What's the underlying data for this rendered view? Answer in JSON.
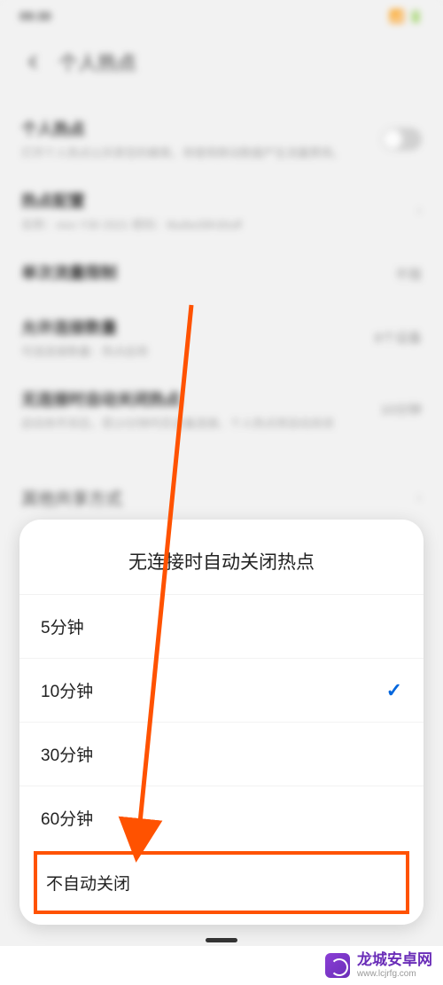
{
  "statusBar": {
    "time": "09:30"
  },
  "header": {
    "title": "个人热点"
  },
  "settings": {
    "hotspot": {
      "title": "个人热点",
      "sub": "打开个人热点以共享您的蜂窝，将使用移动数据产生流量费用。"
    },
    "config": {
      "title": "热点配置",
      "sub": "名称：vivo Y30 2021  密码：9tu8w39h30uff"
    },
    "limit": {
      "title": "单次流量限制",
      "value": "不限"
    },
    "maxConn": {
      "title": "允许连接数量",
      "sub": "可选连接数量：热点启用",
      "value": "8个设备"
    },
    "autoOff": {
      "title": "无连接时自动关闭热点",
      "sub": "启动本开关后，若10分钟内无设备连接，个人热点将自动关闭",
      "value": "10分钟"
    },
    "otherShare": {
      "title": "其他共享方式"
    }
  },
  "modal": {
    "title": "无连接时自动关闭热点",
    "options": [
      {
        "label": "5分钟",
        "selected": false
      },
      {
        "label": "10分钟",
        "selected": true
      },
      {
        "label": "30分钟",
        "selected": false
      },
      {
        "label": "60分钟",
        "selected": false
      }
    ],
    "highlightOption": "不自动关闭"
  },
  "watermark": {
    "main": "龙城安卓网",
    "sub": "www.lcjrfg.com"
  }
}
